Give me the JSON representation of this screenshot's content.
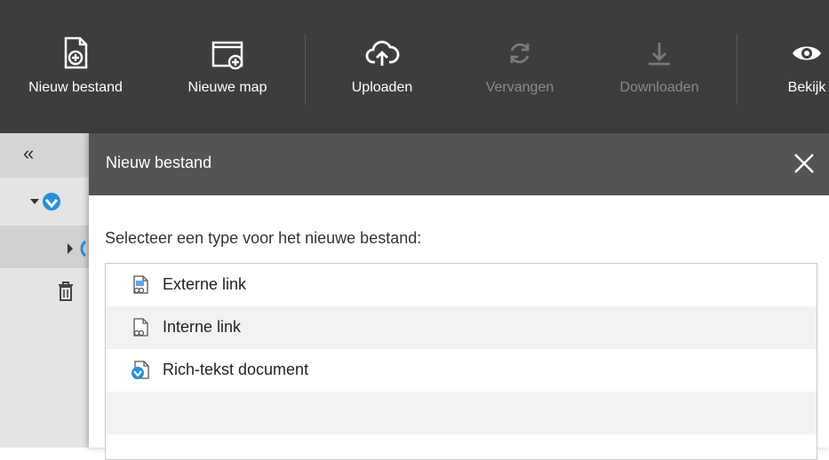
{
  "toolbar": {
    "buttons": [
      {
        "label": "Nieuw bestand",
        "icon": "new-file-icon",
        "enabled": true
      },
      {
        "label": "Nieuwe map",
        "icon": "new-folder-icon",
        "enabled": true
      },
      {
        "label": "Uploaden",
        "icon": "cloud-upload-icon",
        "enabled": true
      },
      {
        "label": "Vervangen",
        "icon": "replace-icon",
        "enabled": false
      },
      {
        "label": "Downloaden",
        "icon": "download-icon",
        "enabled": false
      },
      {
        "label": "Bekijk",
        "icon": "eye-icon",
        "enabled": true
      }
    ]
  },
  "sidebar": {
    "collapse_glyph": "«"
  },
  "dialog": {
    "title": "Nieuw bestand",
    "prompt": "Selecteer een type voor het nieuwe bestand:",
    "types": [
      {
        "label": "Externe link",
        "icon": "external-link-doc-icon"
      },
      {
        "label": "Interne link",
        "icon": "internal-link-doc-icon"
      },
      {
        "label": "Rich-tekst document",
        "icon": "rich-text-doc-icon"
      }
    ]
  },
  "colors": {
    "toolbar_bg": "#3d3d3d",
    "dialog_header_bg": "#545454",
    "tree_accent": "#2a8fd6"
  }
}
